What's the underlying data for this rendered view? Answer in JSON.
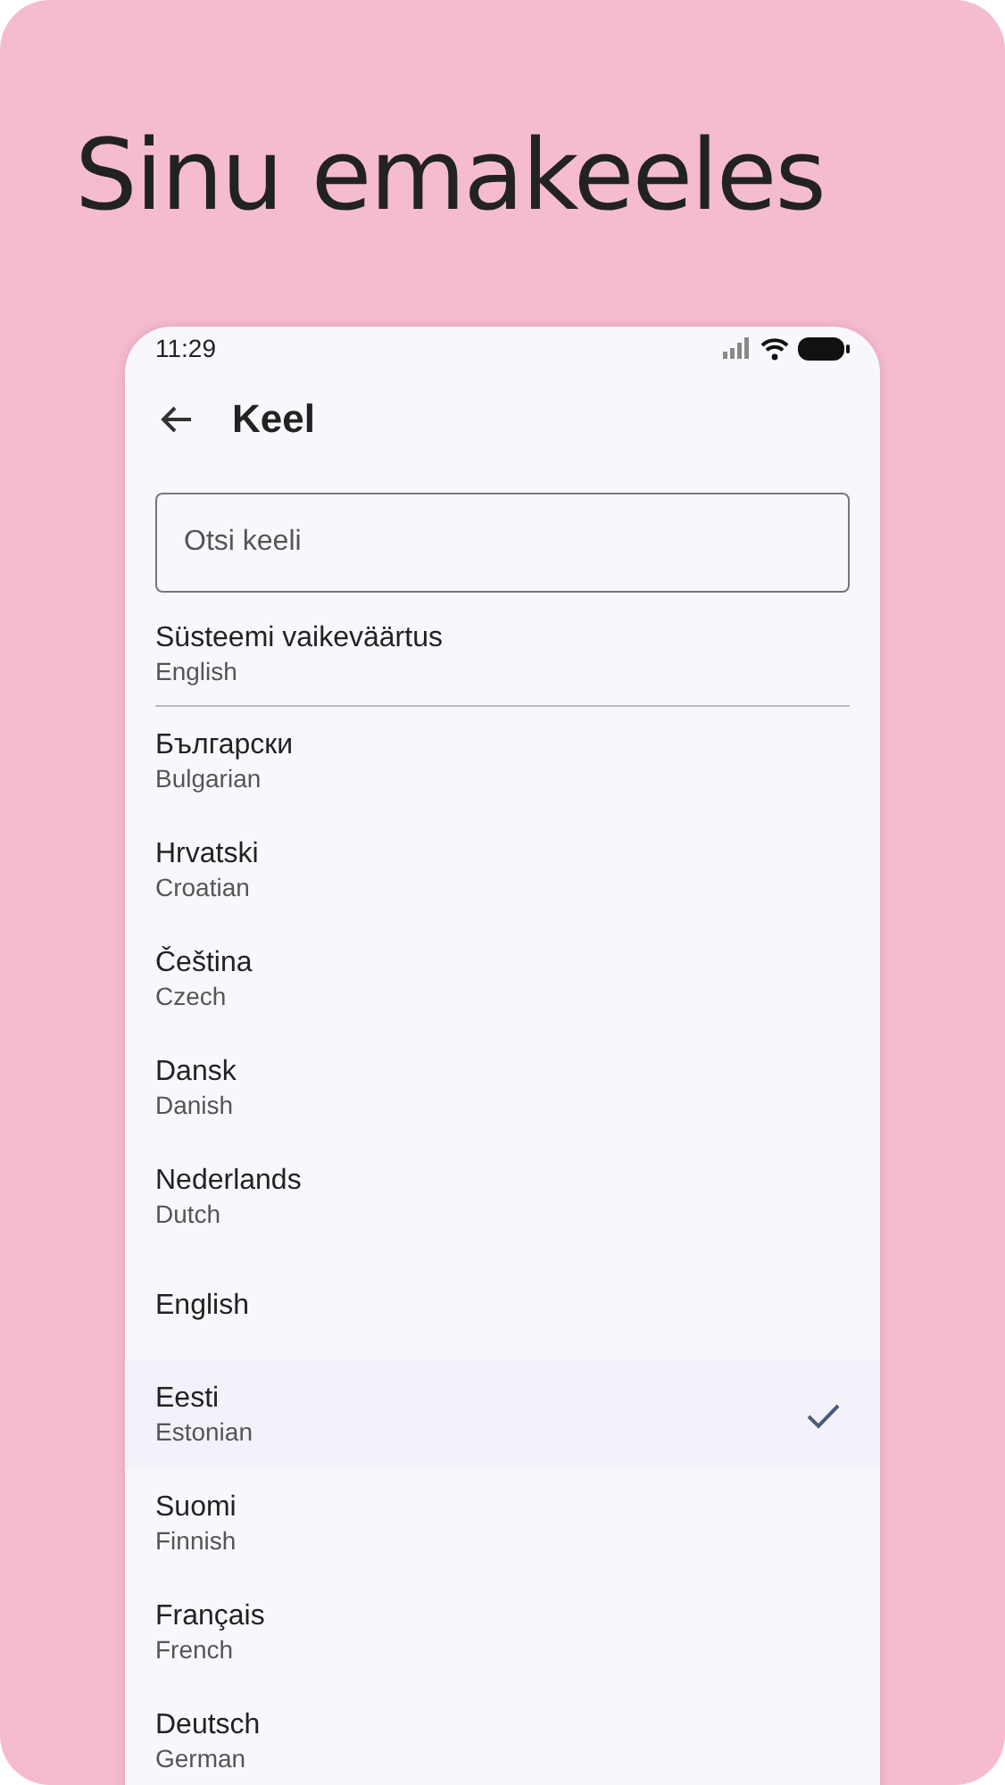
{
  "headline": "Sinu emakeeles",
  "status_bar": {
    "time": "11:29"
  },
  "app_bar": {
    "title": "Keel"
  },
  "search": {
    "placeholder": "Otsi keeli"
  },
  "system_default": {
    "label": "Süsteemi vaikeväärtus",
    "value": "English"
  },
  "languages": [
    {
      "name": "Български",
      "english": "Bulgarian",
      "selected": false
    },
    {
      "name": "Hrvatski",
      "english": "Croatian",
      "selected": false
    },
    {
      "name": "Čeština",
      "english": "Czech",
      "selected": false
    },
    {
      "name": "Dansk",
      "english": "Danish",
      "selected": false
    },
    {
      "name": "Nederlands",
      "english": "Dutch",
      "selected": false
    },
    {
      "name": "English",
      "selected": false
    },
    {
      "name": "Eesti",
      "english": "Estonian",
      "selected": true
    },
    {
      "name": "Suomi",
      "english": "Finnish",
      "selected": false
    },
    {
      "name": "Français",
      "english": "French",
      "selected": false
    },
    {
      "name": "Deutsch",
      "english": "German",
      "selected": false
    }
  ]
}
